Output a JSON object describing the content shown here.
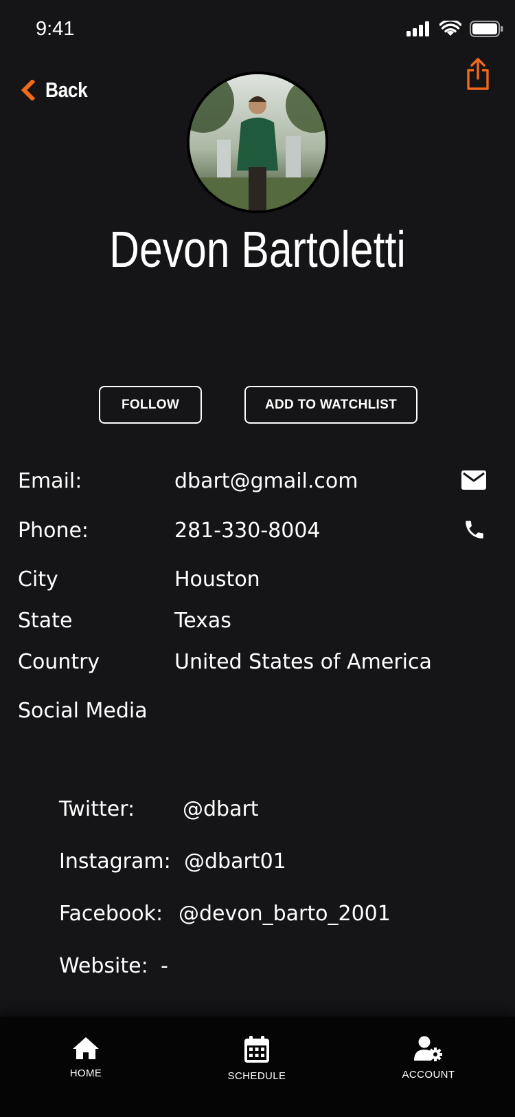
{
  "status_bar": {
    "time": "9:41"
  },
  "header": {
    "back_label": "Back",
    "accent_color": "#F26A1B"
  },
  "profile": {
    "name": "Devon Bartoletti",
    "buttons": {
      "follow": "FOLLOW",
      "watchlist": "ADD TO WATCHLIST"
    }
  },
  "info": {
    "email": {
      "label": "Email:",
      "value": "dbart@gmail.com"
    },
    "phone": {
      "label": "Phone:",
      "value": "281-330-8004"
    },
    "city": {
      "label": "City",
      "value": "Houston"
    },
    "state": {
      "label": "State",
      "value": "Texas"
    },
    "country": {
      "label": "Country",
      "value": "United States of America"
    },
    "social_title": "Social Media"
  },
  "social": {
    "twitter": {
      "label": "Twitter:",
      "value": "@dbart"
    },
    "instagram": {
      "label": "Instagram:",
      "value": "@dbart01"
    },
    "facebook": {
      "label": "Facebook:",
      "value": "@devon_barto_2001"
    },
    "website": {
      "label": "Website:",
      "value": "-"
    }
  },
  "tabbar": {
    "home": "HOME",
    "schedule": "SCHEDULE",
    "account": "ACCOUNT"
  },
  "icons": {
    "back": "chevron-left-icon",
    "share": "share-icon",
    "email": "mail-icon",
    "phone": "phone-icon",
    "home": "home-icon",
    "schedule": "calendar-icon",
    "account": "user-gear-icon"
  }
}
